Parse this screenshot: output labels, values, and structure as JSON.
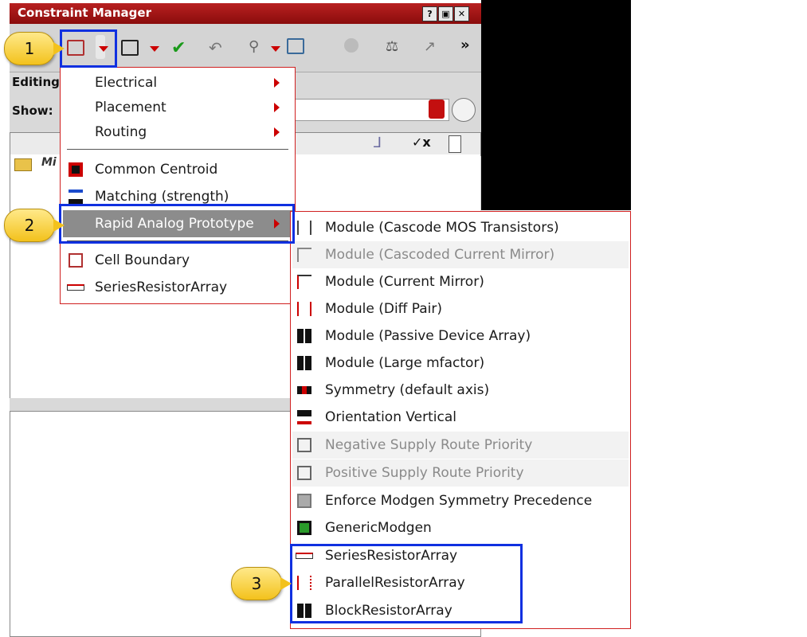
{
  "window": {
    "title": "Constraint Manager",
    "title_buttons": [
      "?",
      "▣",
      "✕"
    ],
    "editing_label": "Editing",
    "show_label": "Show:",
    "tree_item": "Mi"
  },
  "toolbar": {
    "more": "»"
  },
  "callouts": [
    "1",
    "2",
    "3"
  ],
  "main_menu": {
    "items": [
      {
        "label": "Electrical",
        "submenu": true
      },
      {
        "label": "Placement",
        "submenu": true
      },
      {
        "label": "Routing",
        "submenu": true
      },
      {
        "label": "Common Centroid",
        "icon": "common-centroid-icon"
      },
      {
        "label": "Matching (strength)",
        "icon": "matching-icon"
      },
      {
        "label": "Rapid Analog Prototype",
        "submenu": true,
        "highlighted": true
      },
      {
        "label": "Cell Boundary",
        "icon": "cell-boundary-icon"
      },
      {
        "label": "SeriesResistorArray",
        "icon": "series-resistor-icon"
      }
    ]
  },
  "sub_menu": {
    "items": [
      {
        "label": "Module (Cascode MOS Transistors)",
        "icon": "cascode-mos-icon"
      },
      {
        "label": "Module (Cascoded Current Mirror)",
        "icon": "cascoded-mirror-icon",
        "disabled": true
      },
      {
        "label": "Module (Current Mirror)",
        "icon": "current-mirror-icon"
      },
      {
        "label": "Module (Diff Pair)",
        "icon": "diff-pair-icon"
      },
      {
        "label": "Module (Passive Device Array)",
        "icon": "grid-icon"
      },
      {
        "label": "Module (Large mfactor)",
        "icon": "grid-icon"
      },
      {
        "label": "Symmetry (default axis)",
        "icon": "symmetry-icon"
      },
      {
        "label": "Orientation Vertical",
        "icon": "orientation-icon"
      },
      {
        "label": "Negative Supply Route Priority",
        "icon": "route-priority-icon",
        "disabled": true
      },
      {
        "label": "Positive Supply Route Priority",
        "icon": "route-priority-icon",
        "disabled": true
      },
      {
        "label": "Enforce Modgen Symmetry Precedence",
        "icon": "modgen-symmetry-icon"
      },
      {
        "label": "GenericModgen",
        "icon": "generic-modgen-icon"
      },
      {
        "label": "SeriesResistorArray",
        "icon": "series-resistor-icon"
      },
      {
        "label": "ParallelResistorArray",
        "icon": "parallel-resistor-icon"
      },
      {
        "label": "BlockResistorArray",
        "icon": "grid-icon"
      }
    ]
  },
  "colors": {
    "titlebar": "#a01515",
    "highlight_box": "#1030e0",
    "callout": "#f3c21c",
    "menu_border": "#d02020"
  }
}
